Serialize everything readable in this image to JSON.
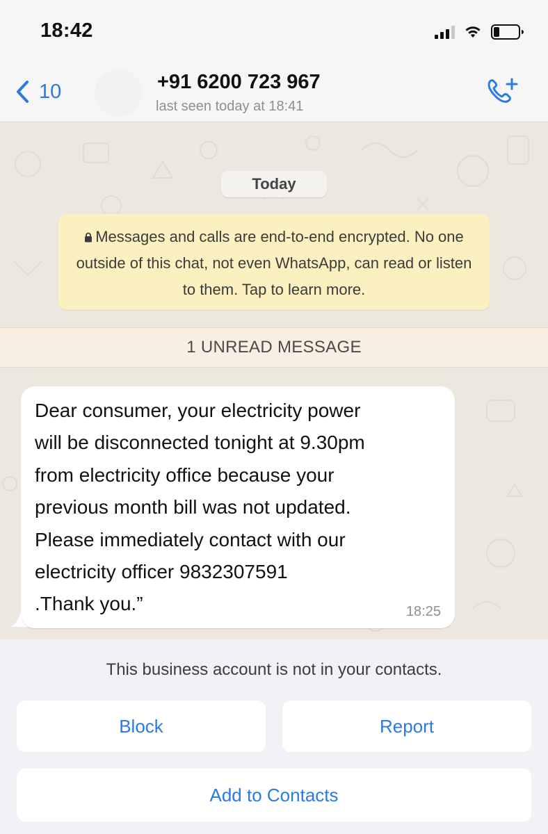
{
  "status_bar": {
    "time": "18:42"
  },
  "header": {
    "back_count": "10",
    "contact_name": "+91 6200 723 967",
    "last_seen": "last seen today at 18:41"
  },
  "chat": {
    "date_chip": "Today",
    "encryption_notice": "Messages and calls are end-to-end encrypted. No one outside of this chat, not even WhatsApp, can read or listen to them. Tap to learn more.",
    "unread_banner": "1 UNREAD MESSAGE",
    "message": {
      "text": "Dear consumer, your electricity power\nwill be disconnected tonight at 9.30pm\nfrom electricity office because your\nprevious month bill was not updated.\nPlease immediately contact with our\nelectricity officer 9832307591\n.Thank you.”",
      "time": "18:25"
    }
  },
  "footer": {
    "notice": "This business account is not in your contacts.",
    "block_label": "Block",
    "report_label": "Report",
    "add_label": "Add to Contacts"
  },
  "colors": {
    "accent": "#2a7ae2",
    "chat_background": "#ece7df",
    "encryption_notice_bg": "#fbf1c0",
    "bubble_bg": "#ffffff"
  }
}
